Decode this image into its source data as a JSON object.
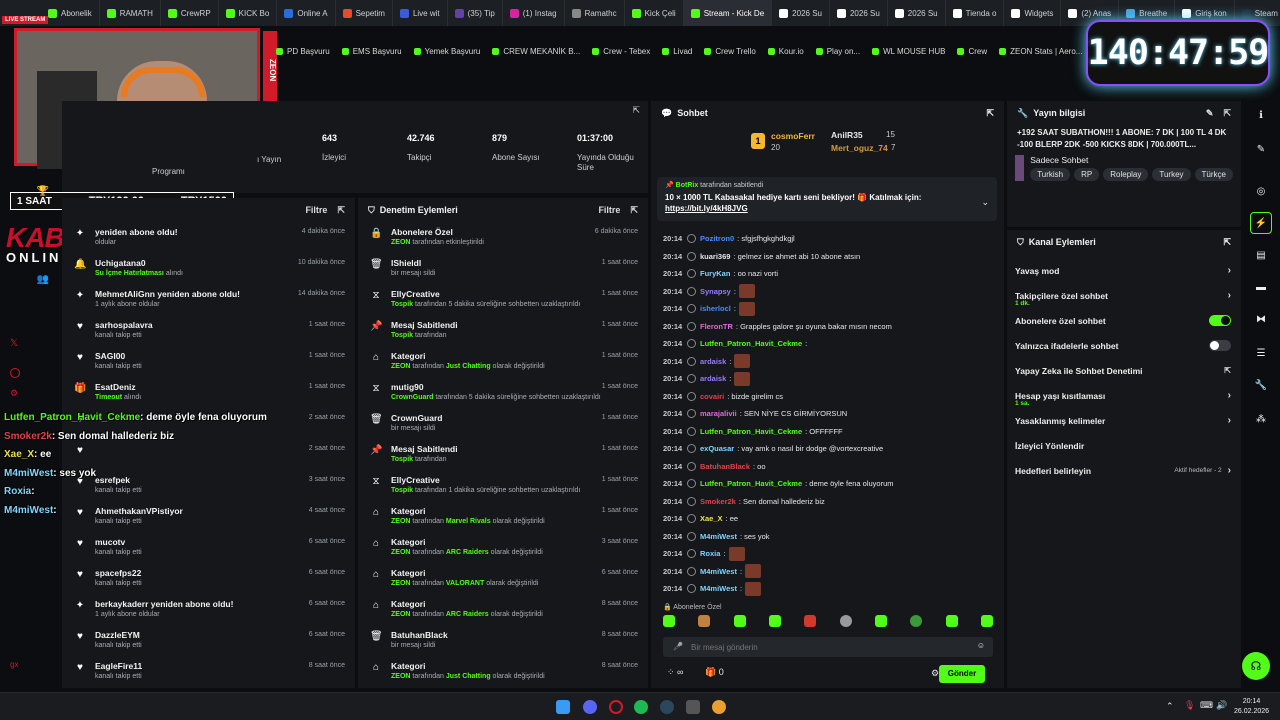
{
  "browser": {
    "tabs": [
      {
        "label": "LIVE STREAM",
        "color": "#d11a2a"
      },
      {
        "label": "Abonelik",
        "color": "#53fc18"
      },
      {
        "label": "RAMATH",
        "color": "#53fc18"
      },
      {
        "label": "CrewRP",
        "color": "#53fc18"
      },
      {
        "label": "KICK Bo",
        "color": "#53fc18"
      },
      {
        "label": "Online A",
        "color": "#2b6cd6"
      },
      {
        "label": "Sepetim",
        "color": "#e44c2b"
      },
      {
        "label": "Live wit",
        "color": "#3b5bdb"
      },
      {
        "label": "(35) Tip",
        "color": "#6441a5"
      },
      {
        "label": "(1) Instag",
        "color": "#d6249f"
      },
      {
        "label": "Ramathc",
        "color": "#888888"
      },
      {
        "label": "Kick Çeli",
        "color": "#53fc18"
      },
      {
        "label": "Stream - Kick De",
        "color": "#53fc18",
        "active": true
      },
      {
        "label": "2026 Su",
        "color": "#ffffff"
      },
      {
        "label": "2026 Su",
        "color": "#ffffff"
      },
      {
        "label": "2026 Su",
        "color": "#ffffff"
      },
      {
        "label": "Tienda o",
        "color": "#ffffff"
      },
      {
        "label": "Widgets",
        "color": "#ffffff"
      },
      {
        "label": "(2) Anas",
        "color": "#ffffff"
      },
      {
        "label": "Breathe",
        "color": "#4a9fd6"
      },
      {
        "label": "Giriş kon",
        "color": "#ffffff"
      },
      {
        "label": "Steam T",
        "color": "#1b2838"
      }
    ],
    "bookmarks": [
      "PD Başvuru",
      "EMS Başvuru",
      "Yemek Başvuru",
      "CREW MEKANİK B...",
      "Crew - Tebex",
      "Livad",
      "Crew Trello",
      "Kour.io",
      "Play on...",
      "WL MOUSE HUB",
      "Crew",
      "ZEON Stats | Aero...",
      "APIq"
    ]
  },
  "overlay": {
    "webcam_brand": "ZEON",
    "timer": "140:47:59",
    "donation_left": "1 SAAT",
    "donation_mid": "TRY190.00",
    "donation_right": "TRY1500",
    "logo_line1": "KABASAKAL",
    "logo_line2": "ONLINE.COM",
    "float_chat": [
      {
        "user": "Lutfen_Patron_Havit_Cekme",
        "text": ": deme öyle fena oluyorum",
        "color": "#53fc18"
      },
      {
        "user": "Smoker2k",
        "text": ": Sen domal hallederiz biz",
        "color": "#e0424c"
      },
      {
        "user": "Xae_X",
        "text": ": ee",
        "color": "#f0e050"
      },
      {
        "user": "M4miWest",
        "text": ": ses yok",
        "color": "#7fd6ff"
      },
      {
        "user": "Roxia",
        "text": ":",
        "color": "#7fd6ff"
      },
      {
        "user": "M4miWest",
        "text": ":",
        "color": "#7fd6ff"
      }
    ]
  },
  "stats": {
    "items": [
      {
        "value": "643",
        "label": "İzleyici"
      },
      {
        "value": "42.746",
        "label": "Takipçi"
      },
      {
        "value": "879",
        "label": "Abone Sayısı"
      },
      {
        "value": "01:37:00",
        "label": "Yayında Olduğu Süre"
      }
    ],
    "partial_label_1": "ı Yayın",
    "partial_label_2": "Programı"
  },
  "activity_feed": {
    "filter": "Filtre",
    "rows": [
      {
        "icon": "star",
        "title": "yeniden abone oldu!",
        "sub": "oldular",
        "time": "4 dakika önce"
      },
      {
        "icon": "bell",
        "title": "Uchigatana0",
        "sub": "Su İçme Hatırlatması",
        "sub_green": true,
        "sub_rest": " alındı",
        "time": "10 dakika önce"
      },
      {
        "icon": "star",
        "title": "MehmetAliGnn yeniden abone oldu!",
        "sub": "1 aylık abone oldular",
        "time": "14 dakika önce"
      },
      {
        "icon": "heart",
        "title": "sarhospalavra",
        "sub": "kanalı takip etti",
        "time": "1 saat önce"
      },
      {
        "icon": "heart",
        "title": "SAGI00",
        "sub": "kanalı takip etti",
        "time": "1 saat önce"
      },
      {
        "icon": "gift",
        "title": "EsatDeniz",
        "sub": "Timeout",
        "sub_green": true,
        "sub_rest": " alındı",
        "time": "1 saat önce"
      },
      {
        "icon": "heart",
        "title": "",
        "sub": "",
        "time": "2 saat önce"
      },
      {
        "icon": "heart",
        "title": "",
        "sub": "",
        "time": "2 saat önce"
      },
      {
        "icon": "heart",
        "title": "esrefpek",
        "sub": "kanalı takip etti",
        "time": "3 saat önce"
      },
      {
        "icon": "heart",
        "title": "AhmethakanVPistiyor",
        "sub": "kanalı takip etti",
        "time": "4 saat önce"
      },
      {
        "icon": "heart",
        "title": "mucotv",
        "sub": "kanalı takip etti",
        "time": "6 saat önce"
      },
      {
        "icon": "heart",
        "title": "spacefps22",
        "sub": "kanalı takip etti",
        "time": "6 saat önce"
      },
      {
        "icon": "star",
        "title": "berkaykaderr yeniden abone oldu!",
        "sub": "1 aylık abone oldular",
        "time": "6 saat önce"
      },
      {
        "icon": "heart",
        "title": "DazzleEYM",
        "sub": "kanalı takip etti",
        "time": "6 saat önce"
      },
      {
        "icon": "heart",
        "title": "EagleFire11",
        "sub": "kanalı takip etti",
        "time": "8 saat önce"
      },
      {
        "icon": "heart",
        "title": "Fuuxx",
        "sub": "kanalı takip etti",
        "time": "8 saat önce"
      }
    ]
  },
  "moderation": {
    "title": "Denetim Eylemleri",
    "filter": "Filtre",
    "rows": [
      {
        "icon": "lock",
        "title": "Abonelere Özel",
        "g": "ZEON",
        "rest": " tarafından etkinleştirildi",
        "time": "6 dakika önce"
      },
      {
        "icon": "trash",
        "title": "lShieldl",
        "g": "",
        "rest": "bir mesajı sildi",
        "time": "1 saat önce"
      },
      {
        "icon": "timer",
        "title": "EllyCreative",
        "g": "Tospik",
        "rest": " tarafından 5 dakika süreliğine sohbetten uzaklaştırıldı",
        "time": "1 saat önce"
      },
      {
        "icon": "pin",
        "title": "Mesaj Sabitlendi",
        "g": "Tospik",
        "rest": " tarafından",
        "time": "1 saat önce"
      },
      {
        "icon": "cat",
        "title": "Kategori",
        "g": "ZEON",
        "rest": " tarafından ",
        "g2": "Just Chatting",
        "rest2": " olarak değiştirildi",
        "time": "1 saat önce"
      },
      {
        "icon": "timer",
        "title": "mutig90",
        "g": "CrownGuard",
        "rest": " tarafından 5 dakika süreliğine sohbetten uzaklaştırıldı",
        "time": "1 saat önce"
      },
      {
        "icon": "trash",
        "title": "CrownGuard",
        "g": "",
        "rest": "bir mesajı sildi",
        "time": "1 saat önce"
      },
      {
        "icon": "pin",
        "title": "Mesaj Sabitlendi",
        "g": "Tospik",
        "rest": " tarafından",
        "time": "1 saat önce"
      },
      {
        "icon": "timer",
        "title": "EllyCreative",
        "g": "Tospik",
        "rest": " tarafından 1 dakika süreliğine sohbetten uzaklaştırıldı",
        "time": "1 saat önce"
      },
      {
        "icon": "cat",
        "title": "Kategori",
        "g": "ZEON",
        "rest": " tarafından ",
        "g2": "Marvel Rivals",
        "rest2": " olarak değiştirildi",
        "time": "1 saat önce"
      },
      {
        "icon": "cat",
        "title": "Kategori",
        "g": "ZEON",
        "rest": " tarafından ",
        "g2": "ARC Raiders",
        "rest2": " olarak değiştirildi",
        "time": "3 saat önce"
      },
      {
        "icon": "cat",
        "title": "Kategori",
        "g": "ZEON",
        "rest": " tarafından ",
        "g2": "VALORANT",
        "rest2": " olarak değiştirildi",
        "time": "6 saat önce"
      },
      {
        "icon": "cat",
        "title": "Kategori",
        "g": "ZEON",
        "rest": " tarafından ",
        "g2": "ARC Raiders",
        "rest2": " olarak değiştirildi",
        "time": "8 saat önce"
      },
      {
        "icon": "trash",
        "title": "BatuhanBlack",
        "g": "",
        "rest": "bir mesajı sildi",
        "time": "8 saat önce"
      },
      {
        "icon": "cat",
        "title": "Kategori",
        "g": "ZEON",
        "rest": " tarafından ",
        "g2": "Just Chatting",
        "rest2": " olarak değiştirildi",
        "time": "8 saat önce"
      }
    ]
  },
  "chat": {
    "title": "Sohbet",
    "top_gifter_1": "cosmoFerr",
    "top_gifter_1_count": "20",
    "top_gifter_2": "AnilR35",
    "top_gifter_2_count": "15",
    "top_gifter_3": "Mert_oguz_74",
    "top_gifter_3_count": "7",
    "pinned_user": "BotRix",
    "pinned_by": " tarafından sabitlendi",
    "pinned_text": "10 × 1000 TL Kabasakal hediye kartı seni bekliyor! 🎁 Katılmak için:",
    "pinned_link": "https://bit.ly/4kH8JVG",
    "messages": [
      {
        "time": "20:14",
        "user": "Pozitron0",
        "color": "#4a8cff",
        "text": ": sfgjsfhgkghdkgjl",
        "emote": false
      },
      {
        "time": "20:14",
        "user": "kuari369",
        "color": "#e8e8e8",
        "text": ": gelmez ise ahmet abi 10 abone atsın",
        "emote": false
      },
      {
        "time": "20:14",
        "user": "FuryKan",
        "color": "#7fd6ff",
        "text": ": oo nazi vorti",
        "emote": false
      },
      {
        "time": "20:14",
        "user": "Synapsy",
        "color": "#9b7bff",
        "text": ":",
        "emote": true
      },
      {
        "time": "20:14",
        "user": "isherlocl",
        "color": "#4a8cff",
        "text": ":",
        "emote": true
      },
      {
        "time": "20:14",
        "user": "FleronTR",
        "color": "#e06bd6",
        "text": ": Grapples galore şu oyuna bakar mısın necom",
        "emote": false
      },
      {
        "time": "20:14",
        "user": "Lutfen_Patron_Havit_Cekme",
        "color": "#53fc18",
        "text": ":",
        "emote": false
      },
      {
        "time": "20:14",
        "user": "ardaisk",
        "color": "#9b7bff",
        "text": ":",
        "emote": true
      },
      {
        "time": "20:14",
        "user": "ardaisk",
        "color": "#9b7bff",
        "text": ":",
        "emote": true
      },
      {
        "time": "20:14",
        "user": "covairi",
        "color": "#e0424c",
        "text": ": bizde girelim cs",
        "emote": false
      },
      {
        "time": "20:14",
        "user": "marajalivii",
        "color": "#e06bd6",
        "text": ": SEN NİYE CS GİRMİYORSUN",
        "emote": false
      },
      {
        "time": "20:14",
        "user": "Lutfen_Patron_Havit_Cekme",
        "color": "#53fc18",
        "text": ": OFFFFFF",
        "emote": false
      },
      {
        "time": "20:14",
        "user": "exQuasar",
        "color": "#7fd6ff",
        "text": ": vay amk o nasıl bir dodge @vortexcreative",
        "emote": false
      },
      {
        "time": "20:14",
        "user": "BatuhanBlack",
        "color": "#e0424c",
        "text": ": oo",
        "emote": false
      },
      {
        "time": "20:14",
        "user": "Lutfen_Patron_Havit_Cekme",
        "color": "#53fc18",
        "text": ": deme öyle fena oluyorum",
        "emote": false
      },
      {
        "time": "20:14",
        "user": "Smoker2k",
        "color": "#e0424c",
        "text": ": Sen domal hallederiz biz",
        "emote": false
      },
      {
        "time": "20:14",
        "user": "Xae_X",
        "color": "#f0e050",
        "text": ": ee",
        "emote": false
      },
      {
        "time": "20:14",
        "user": "M4miWest",
        "color": "#7fd6ff",
        "text": ": ses yok",
        "emote": false
      },
      {
        "time": "20:14",
        "user": "Roxia",
        "color": "#7fd6ff",
        "text": ":",
        "emote": true
      },
      {
        "time": "20:14",
        "user": "M4miWest",
        "color": "#7fd6ff",
        "text": ":",
        "emote": true
      },
      {
        "time": "20:14",
        "user": "M4miWest",
        "color": "#7fd6ff",
        "text": ":",
        "emote": true
      }
    ],
    "mode_label": "Abonelere Özel",
    "input_placeholder": "Bir mesaj gönderin",
    "points": "∞",
    "gifts": "0",
    "send_label": "Gönder"
  },
  "stream_info": {
    "title": "Yayın bilgisi",
    "description": "+192 SAAT SUBATHON!!! 1 ABONE: 7 DK | 100 TL 4 DK -100 BLERP 2DK -500 KICKS 8DK | 700.000TL...",
    "category": "Sadece Sohbet",
    "tags": [
      "Turkish",
      "RP",
      "Roleplay",
      "Turkey",
      "Türkçe"
    ]
  },
  "channel_actions": {
    "title": "Kanal Eylemleri",
    "items": [
      {
        "label": "Yavaş mod",
        "control": "chevron",
        "sub": ""
      },
      {
        "label": "Takipçilere özel sohbet",
        "control": "chevron",
        "sub": "1 dk."
      },
      {
        "label": "Abonelere özel sohbet",
        "control": "toggle-on",
        "sub": ""
      },
      {
        "label": "Yalnızca ifadelerle sohbet",
        "control": "toggle-off",
        "sub": ""
      },
      {
        "label": "Yapay Zeka ile Sohbet Denetimi",
        "control": "external",
        "sub": ""
      },
      {
        "label": "Hesap yaşı kısıtlaması",
        "control": "chevron",
        "sub": "1 sa."
      },
      {
        "label": "Yasaklanmış kelimeler",
        "control": "chevron",
        "sub": ""
      },
      {
        "label": "İzleyici Yönlendir",
        "control": "none",
        "sub": ""
      },
      {
        "label": "Hedefleri belirleyin",
        "control": "chevron",
        "sub": "",
        "extra": "Aktif hedefler - 2"
      }
    ]
  },
  "taskbar": {
    "time": "20:14",
    "date": "26.02.2026"
  },
  "colors": {
    "accent": "#53fc18",
    "panel": "#15171b",
    "bg": "#0b0d10"
  }
}
